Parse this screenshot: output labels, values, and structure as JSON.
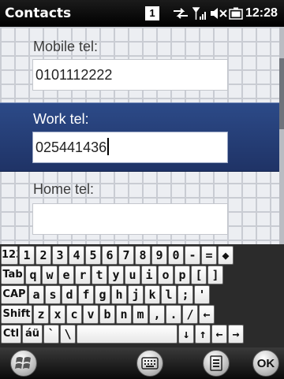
{
  "status_bar": {
    "app_title": "Contacts",
    "notification_count": "1",
    "icons": [
      "network-sync-icon",
      "signal-strength-icon",
      "volume-muted-icon",
      "battery-icon"
    ],
    "time": "12:28"
  },
  "form": {
    "fields": [
      {
        "label": "Mobile tel:",
        "value": "0101112222"
      },
      {
        "label": "Work tel:",
        "value": "025441436"
      },
      {
        "label": "Home tel:",
        "value": ""
      }
    ],
    "selected_index": 1,
    "selected_color": "#24407a"
  },
  "keyboard": {
    "rows": [
      [
        "123",
        "1",
        "2",
        "3",
        "4",
        "5",
        "6",
        "7",
        "8",
        "9",
        "0",
        "-",
        "=",
        "◆"
      ],
      [
        "Tab",
        "q",
        "w",
        "e",
        "r",
        "t",
        "y",
        "u",
        "i",
        "o",
        "p",
        "[",
        "]"
      ],
      [
        "CAP",
        "a",
        "s",
        "d",
        "f",
        "g",
        "h",
        "j",
        "k",
        "l",
        ";",
        "'"
      ],
      [
        "Shift",
        "z",
        "x",
        "c",
        "v",
        "b",
        "n",
        "m",
        ",",
        ".",
        "/",
        "←"
      ],
      [
        "Ctl",
        "áü",
        "`",
        "\\",
        "",
        "↓",
        "↑",
        "←",
        "→"
      ]
    ]
  },
  "softkeys": {
    "start_icon": "windows-start-icon",
    "keyboard_icon": "keyboard-icon",
    "menu_icon": "menu-icon",
    "ok_label": "OK"
  }
}
